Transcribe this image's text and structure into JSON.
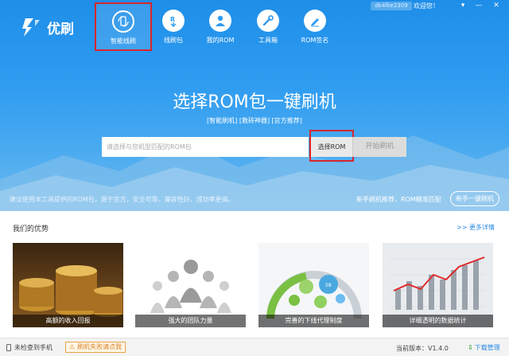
{
  "titlebar": {
    "user": "dk4fke2309",
    "welcome": "欢迎您！",
    "buttons": [
      "menu",
      "minimize",
      "close"
    ]
  },
  "app": {
    "name": "优刷"
  },
  "nav": [
    {
      "label": "智能线刷",
      "icon": "phone-refresh-icon",
      "active": true
    },
    {
      "label": "线刷包",
      "icon": "cloud-r-icon",
      "active": false
    },
    {
      "label": "我的ROM",
      "icon": "user-icon",
      "active": false
    },
    {
      "label": "工具箱",
      "icon": "wrench-icon",
      "active": false
    },
    {
      "label": "ROM签名",
      "icon": "pen-icon",
      "active": false
    }
  ],
  "hero": {
    "headline": "选择ROM包一键刷机",
    "sublinks": "[智能刷机] [救砖神器] [官方推荐]",
    "search_placeholder": "请选择与您机型匹配的ROM包",
    "select_rom": "选择ROM",
    "start_flash": "开始刷机",
    "tip_left": "建议使用本工具提供的ROM包，源于官方，安全可靠，兼容性好，成功率更高。",
    "tip_right": "新手刷机推荐，ROM精准匹配",
    "newbie_button": "新手一键刷机"
  },
  "advantages": {
    "title": "我们的优势",
    "more": ">> 更多详情",
    "cards": [
      {
        "caption": "高额的收入回报"
      },
      {
        "caption": "强大的团队力量"
      },
      {
        "caption": "完善的下线代理制度"
      },
      {
        "caption": "详细透明的数据统计"
      }
    ]
  },
  "status": {
    "phone_status": "未检查到手机",
    "fail_button": "刷机失败请点我",
    "version": "当前版本：V1.4.0",
    "download": "下载管理"
  },
  "colors": {
    "primary": "#2f9cf0",
    "highlight": "#d9262d",
    "link": "#2b8be6"
  }
}
